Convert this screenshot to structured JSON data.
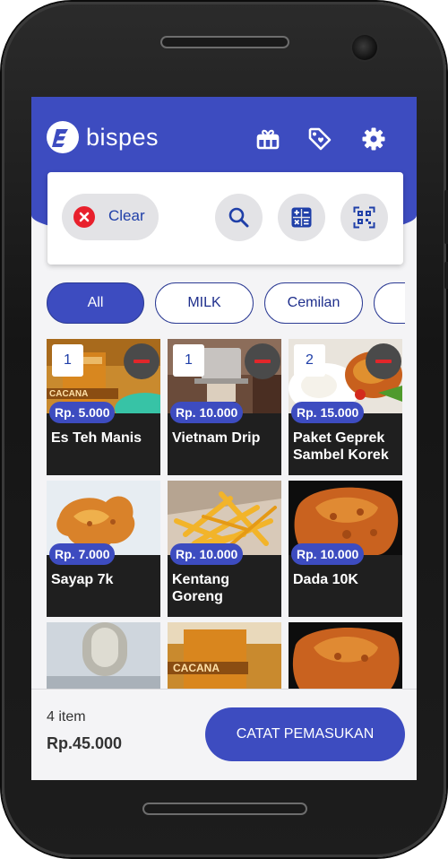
{
  "app": {
    "name": "bispes",
    "brand_color": "#3d4cc0",
    "header_icons": [
      "gift-icon",
      "tag-icon",
      "gear-icon"
    ]
  },
  "actions": {
    "clear_label": "Clear",
    "buttons": [
      "search-icon",
      "calculator-icon",
      "qr-scan-icon"
    ]
  },
  "categories": [
    {
      "label": "All",
      "selected": true
    },
    {
      "label": "MILK",
      "selected": false
    },
    {
      "label": "Cemilan",
      "selected": false
    }
  ],
  "products": [
    {
      "name": "Es Teh Manis",
      "price": "Rp. 5.000",
      "qty": "1"
    },
    {
      "name": "Vietnam Drip",
      "price": "Rp. 10.000",
      "qty": "1"
    },
    {
      "name": "Paket Geprek Sambel Korek",
      "price": "Rp. 15.000",
      "qty": "2"
    },
    {
      "name": "Sayap 7k",
      "price": "Rp. 7.000",
      "qty": ""
    },
    {
      "name": "Kentang Goreng",
      "price": "Rp. 10.000",
      "qty": ""
    },
    {
      "name": "Dada 10K",
      "price": "Rp. 10.000",
      "qty": ""
    }
  ],
  "footer": {
    "item_count": "4 item",
    "total": "Rp.45.000",
    "cta_label": "CATAT PEMASUKAN"
  }
}
